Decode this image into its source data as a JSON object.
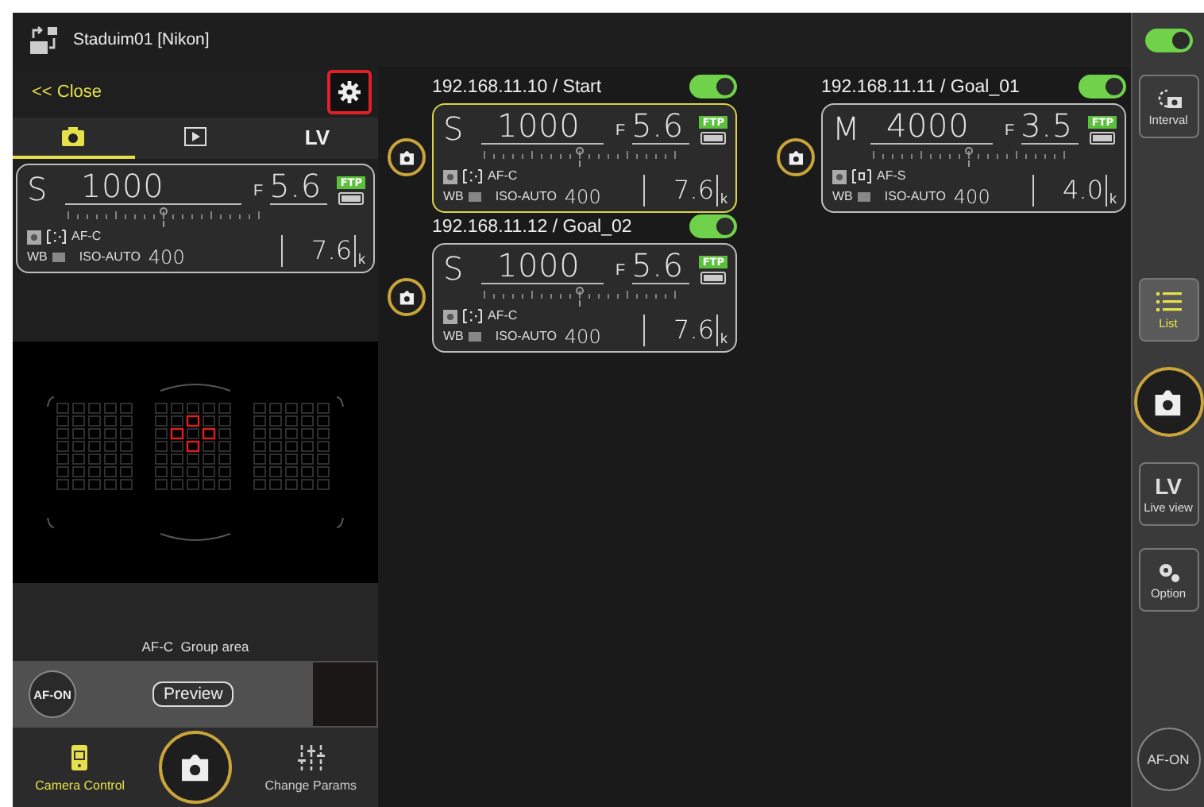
{
  "header": {
    "title": "Staduim01 [Nikon]"
  },
  "left_panel": {
    "close_label": "<< Close",
    "settings_highlighted": true,
    "tabs": [
      {
        "kind": "camera",
        "selected": true
      },
      {
        "kind": "playback",
        "selected": false
      },
      {
        "kind": "text",
        "label": "LV",
        "selected": false
      }
    ],
    "display": {
      "mode": "S",
      "shutter": "1000",
      "f_label": "F",
      "aperture": "5.6",
      "ftp": "FTP",
      "af_area": {
        "kind": "dynamic"
      },
      "af_mode": "AF-C",
      "wb": "WB",
      "iso_label": "ISO-AUTO",
      "iso": "400",
      "remaining": "7.6",
      "unit": "k"
    },
    "af_status": "AF-C  Group area",
    "af_on_label": "AF-ON",
    "preview_label": "Preview",
    "nav": [
      {
        "kind": "camera-control",
        "label": "Camera Control",
        "selected": true
      },
      {
        "kind": "shutter"
      },
      {
        "kind": "params",
        "label": "Change Params",
        "selected": false
      }
    ]
  },
  "cameras": [
    {
      "title": "192.168.11.10 / Start",
      "on": true,
      "selected": true,
      "display": {
        "mode": "S",
        "shutter": "1000",
        "f_label": "F",
        "aperture": "5.6",
        "ftp": "FTP",
        "af_area": {
          "kind": "dynamic"
        },
        "af_mode": "AF-C",
        "wb": "WB",
        "iso_label": "ISO-AUTO",
        "iso": "400",
        "remaining": "7.6",
        "unit": "k"
      }
    },
    {
      "title": "192.168.11.11 / Goal_01",
      "on": true,
      "selected": false,
      "display": {
        "mode": "M",
        "shutter": "4000",
        "f_label": "F",
        "aperture": "3.5",
        "ftp": "FTP",
        "af_area": {
          "kind": "single"
        },
        "af_mode": "AF-S",
        "wb": "WB",
        "iso_label": "ISO-AUTO",
        "iso": "400",
        "remaining": "4.0",
        "unit": "k"
      }
    },
    {
      "title": "192.168.11.12 / Goal_02",
      "on": true,
      "selected": false,
      "display": {
        "mode": "S",
        "shutter": "1000",
        "f_label": "F",
        "aperture": "5.6",
        "ftp": "FTP",
        "af_area": {
          "kind": "dynamic"
        },
        "af_mode": "AF-C",
        "wb": "WB",
        "iso_label": "ISO-AUTO",
        "iso": "400",
        "remaining": "7.6",
        "unit": "k"
      }
    }
  ],
  "sidebar": {
    "power_on": true,
    "items": [
      {
        "kind": "interval",
        "label": "Interval",
        "selected": false
      },
      {
        "kind": "list",
        "label": "List",
        "selected": true
      },
      {
        "kind": "shutter"
      },
      {
        "kind": "lv",
        "icon_text": "LV",
        "label": "Live view",
        "selected": false
      },
      {
        "kind": "option",
        "label": "Option",
        "selected": false
      },
      {
        "kind": "af-on",
        "label": "AF-ON"
      }
    ]
  }
}
